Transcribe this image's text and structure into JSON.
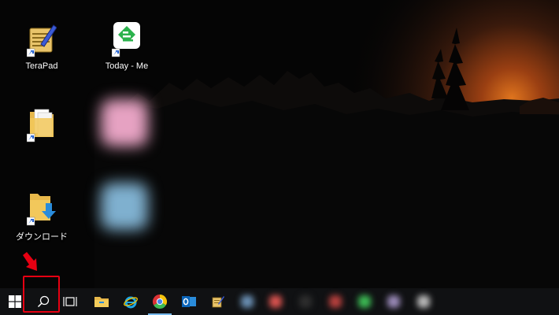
{
  "desktop": {
    "icons": [
      {
        "label": "TeraPad",
        "icon": "terapad-icon"
      },
      {
        "label": "Today - Me",
        "icon": "feedly-icon"
      },
      {
        "label": "",
        "icon": "folder-icon"
      },
      {
        "label": "ダウンロード",
        "icon": "downloads-folder-icon"
      }
    ]
  },
  "taskbar": {
    "buttons": [
      {
        "icon": "windows-start-icon"
      },
      {
        "icon": "search-icon"
      },
      {
        "icon": "task-view-icon"
      },
      {
        "icon": "file-explorer-icon"
      },
      {
        "icon": "internet-explorer-icon"
      },
      {
        "icon": "chrome-icon"
      },
      {
        "icon": "outlook-icon"
      },
      {
        "icon": "terapad-taskbar-icon"
      }
    ]
  },
  "annotation": {
    "highlight_color": "#e60012",
    "target": "search-icon"
  },
  "colors": {
    "taskbar_bg": "#101113",
    "active_indicator": "#76b9ed",
    "sky_glow": "#d9681a"
  }
}
